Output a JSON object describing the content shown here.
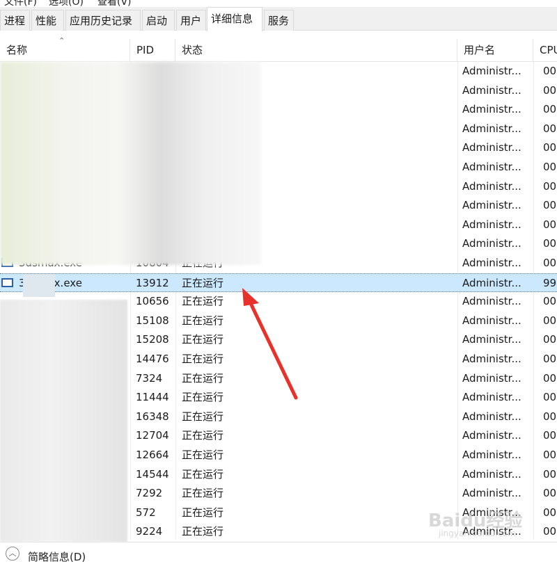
{
  "menu": {
    "items": [
      "文件(F)",
      "选项(O)",
      "查看(V)"
    ]
  },
  "tabs": [
    {
      "label": "进程"
    },
    {
      "label": "性能"
    },
    {
      "label": "应用历史记录"
    },
    {
      "label": "启动"
    },
    {
      "label": "用户"
    },
    {
      "label": "详细信息",
      "active": true
    },
    {
      "label": "服务"
    }
  ],
  "columns": {
    "name": "名称",
    "pid": "PID",
    "status": "状态",
    "user": "用户名",
    "cpu": "CPU"
  },
  "rows": [
    {
      "name": "",
      "pid": "",
      "status": "",
      "user": "Administr...",
      "cpu": "00"
    },
    {
      "name": "",
      "pid": "",
      "status": "",
      "user": "Administr...",
      "cpu": "00"
    },
    {
      "name": "",
      "pid": "",
      "status": "",
      "user": "Administr...",
      "cpu": "00"
    },
    {
      "name": "",
      "pid": "",
      "status": "",
      "user": "Administr...",
      "cpu": "00"
    },
    {
      "name": "",
      "pid": "",
      "status": "",
      "user": "Administr...",
      "cpu": "00"
    },
    {
      "name": "",
      "pid": "",
      "status": "",
      "user": "Administr...",
      "cpu": "00"
    },
    {
      "name": "",
      "pid": "",
      "status": "",
      "user": "Administr...",
      "cpu": "00"
    },
    {
      "name": "",
      "pid": "",
      "status": "",
      "user": "Administr...",
      "cpu": "00"
    },
    {
      "name": "",
      "pid": "",
      "status": "",
      "user": "Administr...",
      "cpu": "00"
    },
    {
      "name": "",
      "pid": "",
      "status": "",
      "user": "Administr...",
      "cpu": "00"
    },
    {
      "name": "3dsmax.exe",
      "pid": "10804",
      "status": "正在运行",
      "user": "Administr...",
      "cpu": "00"
    },
    {
      "name": "3dsmax.exe",
      "pid": "13912",
      "status": "正在运行",
      "user": "Administr...",
      "cpu": "99",
      "selected": true
    },
    {
      "name": "",
      "pid": "10656",
      "status": "正在运行",
      "user": "Administr...",
      "cpu": "00"
    },
    {
      "name": "",
      "pid": "15108",
      "status": "正在运行",
      "user": "Administr...",
      "cpu": "00"
    },
    {
      "name": "",
      "pid": "15208",
      "status": "正在运行",
      "user": "Administr...",
      "cpu": "00"
    },
    {
      "name": "",
      "pid": "14476",
      "status": "正在运行",
      "user": "Administr...",
      "cpu": "00"
    },
    {
      "name": "",
      "pid": "7324",
      "status": "正在运行",
      "user": "Administr...",
      "cpu": "00"
    },
    {
      "name": "",
      "pid": "11444",
      "status": "正在运行",
      "user": "Administr...",
      "cpu": "00"
    },
    {
      "name": "",
      "pid": "16348",
      "status": "正在运行",
      "user": "Administr...",
      "cpu": "00"
    },
    {
      "name": "",
      "pid": "12704",
      "status": "正在运行",
      "user": "Administr...",
      "cpu": "00"
    },
    {
      "name": "",
      "pid": "12664",
      "status": "正在运行",
      "user": "Administr...",
      "cpu": "00"
    },
    {
      "name": "",
      "pid": "14544",
      "status": "正在运行",
      "user": "Administr...",
      "cpu": "00"
    },
    {
      "name": "",
      "pid": "7292",
      "status": "正在运行",
      "user": "Administr...",
      "cpu": "00"
    },
    {
      "name": "",
      "pid": "572",
      "status": "正在运行",
      "user": "Administr...",
      "cpu": "00"
    },
    {
      "name": "",
      "pid": "9224",
      "status": "正在运行",
      "user": "Administr...",
      "cpu": "00"
    }
  ],
  "footer": {
    "label": "简略信息(D)"
  },
  "watermark": {
    "text": "Baidu经验",
    "sub": "jingyan.baidu.com"
  },
  "colors": {
    "selection": "#cce8ff",
    "arrow": "#e8312a",
    "tab_bar": "#f0f0f0"
  }
}
